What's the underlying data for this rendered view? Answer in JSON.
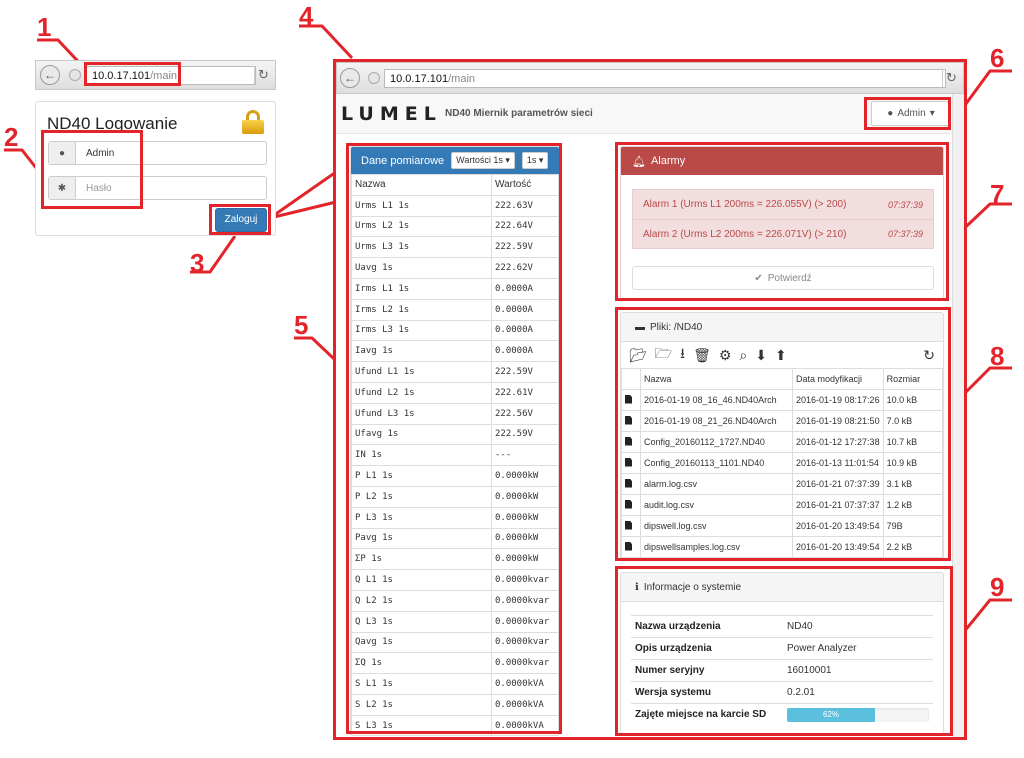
{
  "callouts": [
    "1",
    "2",
    "3",
    "4",
    "5",
    "6",
    "7",
    "8",
    "9"
  ],
  "login_browser": {
    "url_host": "10.0.17.101",
    "url_path": "/main"
  },
  "login": {
    "title": "ND40 Logowanie",
    "username_value": "Admin",
    "password_placeholder": "Hasło",
    "submit_label": "Zaloguj"
  },
  "main_browser": {
    "url_host": "10.0.17.101",
    "url_path": "/main"
  },
  "navbar": {
    "logo": "LUMEL",
    "title": "ND40 Miernik parametrów sieci",
    "user_menu": "Admin"
  },
  "measurements": {
    "header_label": "Dane pomiarowe",
    "values_dropdown": "Wartości 1s",
    "interval_dropdown": "1s",
    "columns": [
      "Nazwa",
      "Wartość"
    ],
    "rows": [
      [
        "Urms L1 1s",
        "222.63V"
      ],
      [
        "Urms L2 1s",
        "222.64V"
      ],
      [
        "Urms L3 1s",
        "222.59V"
      ],
      [
        "Uavg 1s",
        "222.62V"
      ],
      [
        "Irms L1 1s",
        "0.0000A"
      ],
      [
        "Irms L2 1s",
        "0.0000A"
      ],
      [
        "Irms L3 1s",
        "0.0000A"
      ],
      [
        "Iavg 1s",
        "0.0000A"
      ],
      [
        "Ufund L1 1s",
        "222.59V"
      ],
      [
        "Ufund L2 1s",
        "222.61V"
      ],
      [
        "Ufund L3 1s",
        "222.56V"
      ],
      [
        "Ufavg 1s",
        "222.59V"
      ],
      [
        "IN 1s",
        "---"
      ],
      [
        "P L1 1s",
        "0.0000kW"
      ],
      [
        "P L2 1s",
        "0.0000kW"
      ],
      [
        "P L3 1s",
        "0.0000kW"
      ],
      [
        "Pavg 1s",
        "0.0000kW"
      ],
      [
        "ΣP 1s",
        "0.0000kW"
      ],
      [
        "Q L1 1s",
        "0.0000kvar"
      ],
      [
        "Q L2 1s",
        "0.0000kvar"
      ],
      [
        "Q L3 1s",
        "0.0000kvar"
      ],
      [
        "Qavg 1s",
        "0.0000kvar"
      ],
      [
        "ΣQ 1s",
        "0.0000kvar"
      ],
      [
        "S L1 1s",
        "0.0000kVA"
      ],
      [
        "S L2 1s",
        "0.0000kVA"
      ],
      [
        "S L3 1s",
        "0.0000kVA"
      ]
    ]
  },
  "alarms": {
    "title": "Alarmy",
    "items": [
      {
        "text": "Alarm 1 (Urms L1 200ms = 226.055V) (> 200)",
        "time": "07:37:39"
      },
      {
        "text": "Alarm 2 (Urms L2 200ms = 226.071V) (> 210)",
        "time": "07:37:39"
      }
    ],
    "confirm_label": "Potwierdź"
  },
  "files": {
    "title": "Pliki: /ND40",
    "columns": [
      "Nazwa",
      "Data modyfikacji",
      "Rozmiar"
    ],
    "rows": [
      [
        "2016-01-19 08_16_46.ND40Arch",
        "2016-01-19 08:17:26",
        "10.0 kB"
      ],
      [
        "2016-01-19 08_21_26.ND40Arch",
        "2016-01-19 08:21:50",
        "7.0 kB"
      ],
      [
        "Config_20160112_1727.ND40",
        "2016-01-12 17:27:38",
        "10.7 kB"
      ],
      [
        "Config_20160113_1101.ND40",
        "2016-01-13 11:01:54",
        "10.9 kB"
      ],
      [
        "alarm.log.csv",
        "2016-01-21 07:37:39",
        "3.1 kB"
      ],
      [
        "audit.log.csv",
        "2016-01-21 07:37:37",
        "1.2 kB"
      ],
      [
        "dipswell.log.csv",
        "2016-01-20 13:49:54",
        "79B"
      ],
      [
        "dipswellsamples.log.csv",
        "2016-01-20 13:49:54",
        "2.2 kB"
      ]
    ]
  },
  "system_info": {
    "title": "Informacje o systemie",
    "device_name_label": "Nazwa urządzenia",
    "device_name": "ND40",
    "device_desc_label": "Opis urządzenia",
    "device_desc": "Power Analyzer",
    "serial_label": "Numer seryjny",
    "serial": "16010001",
    "version_label": "Wersja systemu",
    "version": "0.2.01",
    "sd_label": "Zajęte miejsce na karcie SD",
    "sd_used_text": "62%",
    "sd_used_fraction": 0.62
  },
  "colors": {
    "annotation_red": "#e3242b",
    "primary_blue": "#337ab7",
    "danger_red": "#b94a48",
    "progress_cyan": "#5bc0de"
  }
}
